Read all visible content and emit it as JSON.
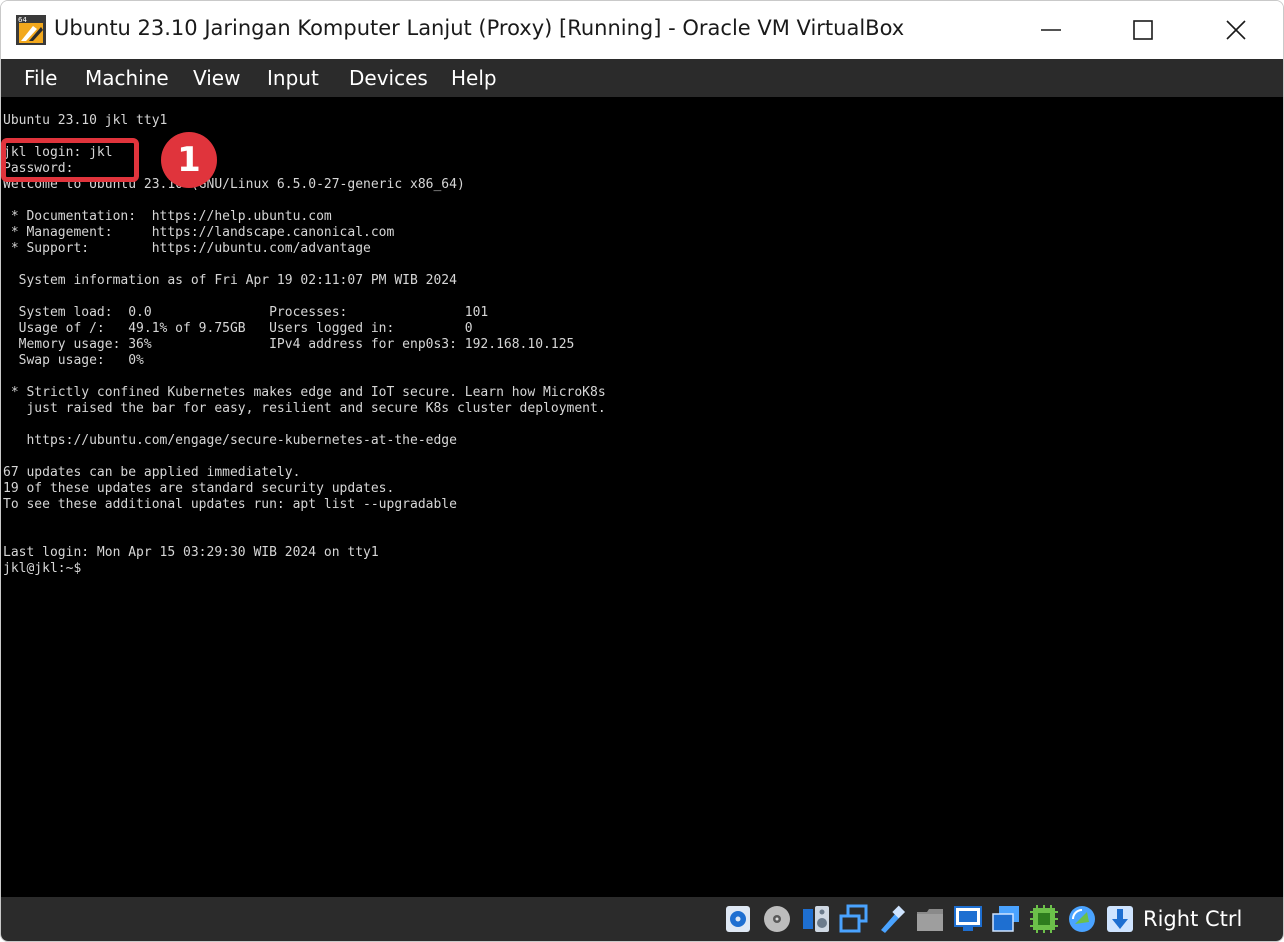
{
  "window": {
    "title": "Ubuntu 23.10 Jaringan Komputer Lanjut (Proxy) [Running] - Oracle VM VirtualBox",
    "icon_badge": "64"
  },
  "menu": {
    "items": [
      {
        "label": "File"
      },
      {
        "label": "Machine"
      },
      {
        "label": "View"
      },
      {
        "label": "Input"
      },
      {
        "label": "Devices"
      },
      {
        "label": "Help"
      }
    ]
  },
  "console": {
    "lines": [
      "Ubuntu 23.10 jkl tty1",
      "",
      "jkl login: jkl",
      "Password:",
      "Welcome to Ubuntu 23.10 (GNU/Linux 6.5.0-27-generic x86_64)",
      "",
      " * Documentation:  https://help.ubuntu.com",
      " * Management:     https://landscape.canonical.com",
      " * Support:        https://ubuntu.com/advantage",
      "",
      "  System information as of Fri Apr 19 02:11:07 PM WIB 2024",
      "",
      "  System load:  0.0               Processes:               101",
      "  Usage of /:   49.1% of 9.75GB   Users logged in:         0",
      "  Memory usage: 36%               IPv4 address for enp0s3: 192.168.10.125",
      "  Swap usage:   0%",
      "",
      " * Strictly confined Kubernetes makes edge and IoT secure. Learn how MicroK8s",
      "   just raised the bar for easy, resilient and secure K8s cluster deployment.",
      "",
      "   https://ubuntu.com/engage/secure-kubernetes-at-the-edge",
      "",
      "67 updates can be applied immediately.",
      "19 of these updates are standard security updates.",
      "To see these additional updates run: apt list --upgradable",
      "",
      "",
      "Last login: Mon Apr 15 03:29:30 WIB 2024 on tty1",
      "jkl@jkl:~$"
    ]
  },
  "annotation": {
    "badge_label": "1",
    "color": "#e0343c"
  },
  "statusbar": {
    "icons": [
      "hard-disk-icon",
      "optical-drive-icon",
      "audio-icon",
      "network-icon",
      "usb-icon",
      "shared-folders-icon",
      "display-icon",
      "recording-icon",
      "cpu-virtualization-icon",
      "mouse-integration-icon",
      "keyboard-capture-icon"
    ],
    "host_key": "Right Ctrl"
  },
  "colors": {
    "menubar_bg": "#2b2b2b",
    "screen_bg": "#000000",
    "console_text": "#d6d6d6",
    "accent_blue": "#1e6fd1"
  }
}
